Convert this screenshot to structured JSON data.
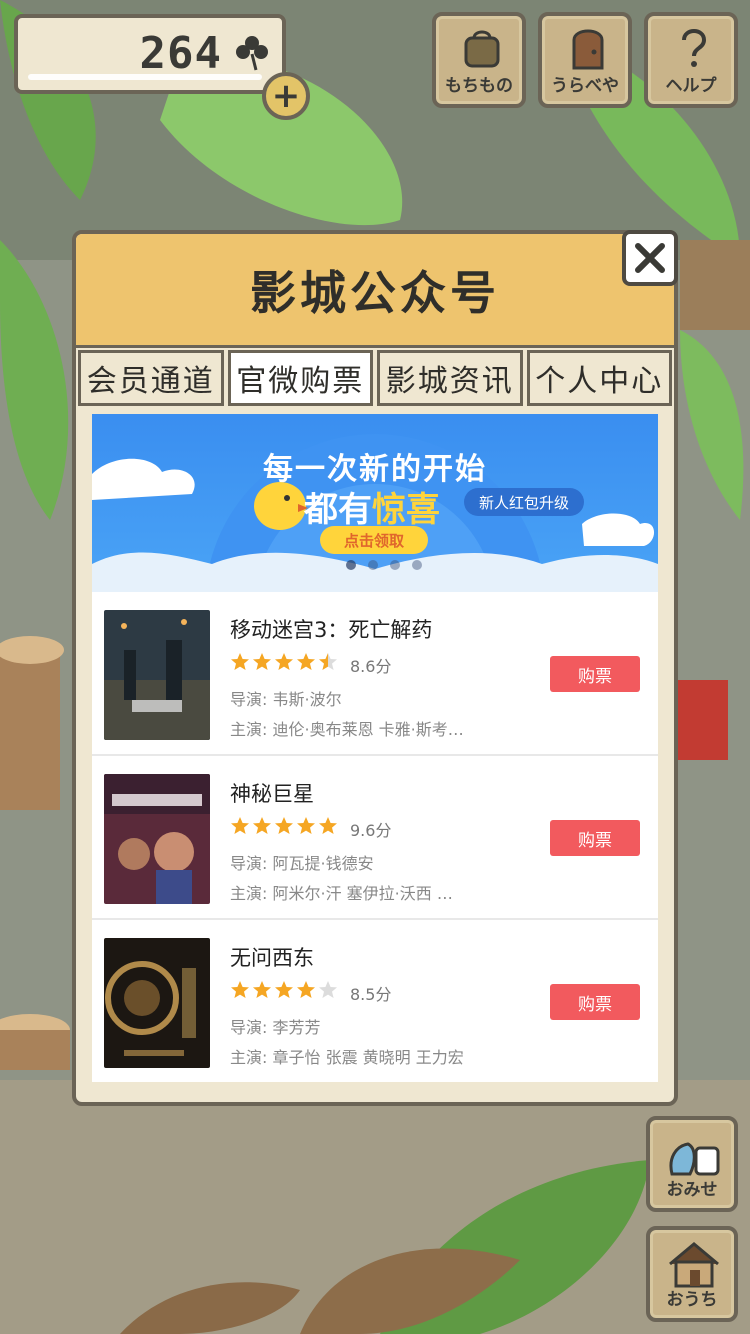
{
  "hud": {
    "clover_count": "264",
    "plus_label": "+",
    "buttons": [
      {
        "label": "もちもの",
        "icon": "bag-icon"
      },
      {
        "label": "うらべや",
        "icon": "door-icon"
      },
      {
        "label": "ヘルプ",
        "icon": "help-icon"
      }
    ]
  },
  "corner_buttons": [
    {
      "label": "おみせ",
      "icon": "shop-bags-icon"
    },
    {
      "label": "おうち",
      "icon": "house-icon"
    }
  ],
  "dialog": {
    "title": "影城公众号",
    "tabs": [
      {
        "label": "会员通道",
        "active": false
      },
      {
        "label": "官微购票",
        "active": true
      },
      {
        "label": "影城资讯",
        "active": false
      },
      {
        "label": "个人中心",
        "active": false
      }
    ],
    "banner": {
      "headline": "每一次新的开始",
      "sub_prefix": "都有",
      "sub_highlight": "惊喜",
      "pill": "新人红包升级",
      "cta": "点击领取",
      "dots": 4,
      "active_dot": 0
    },
    "movies": [
      {
        "title": "移动迷宫3：死亡解药",
        "rating": 4.5,
        "score": "8.6分",
        "director": "导演: 韦斯·波尔",
        "cast": "主演: 迪伦·奥布莱恩 卡雅·斯考…",
        "buy": "购票"
      },
      {
        "title": "神秘巨星",
        "rating": 5,
        "score": "9.6分",
        "director": "导演: 阿瓦提·钱德安",
        "cast": "主演: 阿米尔·汗 塞伊拉·沃西 …",
        "buy": "购票"
      },
      {
        "title": "无问西东",
        "rating": 4,
        "score": "8.5分",
        "director": "导演: 李芳芳",
        "cast": "主演: 章子怡 张震 黄晓明 王力宏",
        "buy": "购票"
      }
    ]
  },
  "colors": {
    "header": "#eec46e",
    "panel": "#efe7d1",
    "border": "#6b6456",
    "buy": "#f25a5e",
    "star": "#f5a623",
    "banner": "#3a8ef0"
  }
}
